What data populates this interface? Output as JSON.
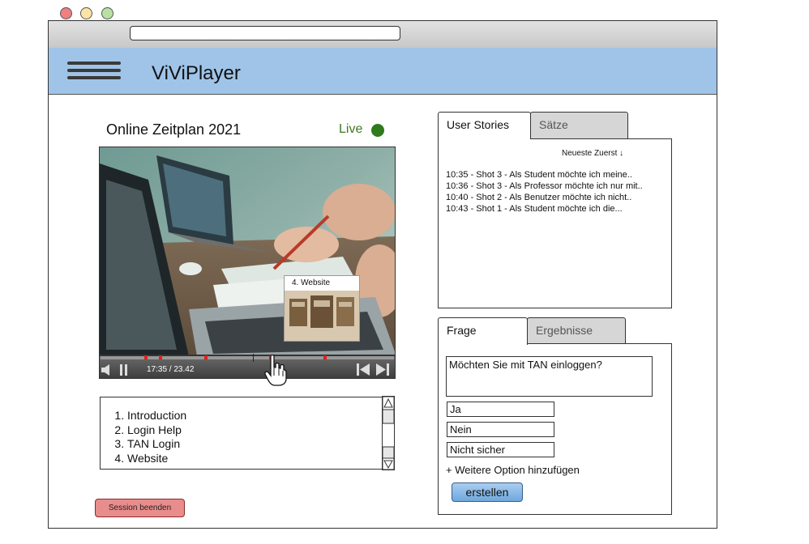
{
  "app": {
    "title": "ViViPlayer"
  },
  "session": {
    "title": "Online Zeitplan 2021",
    "live_label": "Live"
  },
  "player": {
    "time": "17:35 / 23.42",
    "thumbnail_label": "4. Website",
    "markers_percent": [
      15.5,
      20.5,
      36,
      58,
      76.5
    ]
  },
  "chapters": [
    "Introduction",
    "Login Help",
    "TAN Login",
    "Website"
  ],
  "session_end_button": "Session beenden",
  "stories_panel": {
    "tabs": [
      {
        "label": "User Stories",
        "active": true
      },
      {
        "label": "Sätze",
        "active": false
      }
    ],
    "sort_label": "Neueste Zuerst ↓",
    "items": [
      "10:35 - Shot 3 - Als Student möchte ich meine..",
      "10:36 - Shot 3 - Als Professor möchte ich nur mit..",
      "10:40 - Shot 2 - Als Benutzer möchte ich nicht..",
      "10:43 - Shot 1 - Als Student möchte ich die..."
    ]
  },
  "poll_panel": {
    "tabs": [
      {
        "label": "Frage",
        "active": true
      },
      {
        "label": "Ergebnisse",
        "active": false
      }
    ],
    "question": "Möchten Sie mit TAN einloggen?",
    "options": [
      "Ja",
      "Nein",
      "Nicht sicher"
    ],
    "add_option_label": "+ Weitere Option hinzufügen",
    "create_button": "erstellen"
  },
  "colors": {
    "header": "#9fc4e8",
    "live": "#2f7a1d",
    "marker": "#e0201c",
    "session_button": "#e98c8c",
    "create_button": "#6ea8dc"
  },
  "icons": [
    "menu-icon",
    "volume-icon",
    "pause-icon",
    "skip-back-icon",
    "skip-forward-icon",
    "hand-cursor-icon",
    "scroll-up-icon",
    "scroll-down-icon",
    "sort-down-icon"
  ]
}
